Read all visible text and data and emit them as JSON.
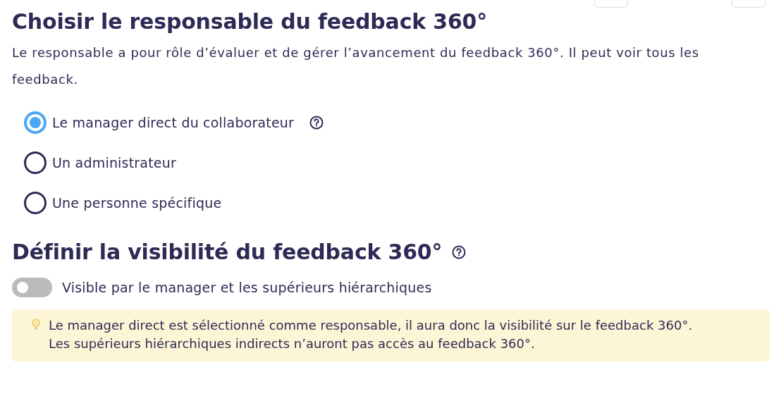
{
  "owner_section": {
    "title": "Choisir le responsable du feedback 360°",
    "description": "Le responsable a pour rôle d’évaluer et de gérer l’avancement du feedback 360°. Il peut voir tous les feedback.",
    "options": [
      {
        "label": "Le manager direct du collaborateur",
        "selected": true,
        "help": true
      },
      {
        "label": "Un administrateur",
        "selected": false,
        "help": false
      },
      {
        "label": "Une personne spécifique",
        "selected": false,
        "help": false
      }
    ]
  },
  "visibility_section": {
    "title": "Définir la visibilité du feedback 360°",
    "help": true,
    "toggle": {
      "label": "Visible par le manager et les supérieurs hiérarchiques",
      "on": false
    },
    "info": [
      "Le manager direct est sélectionné comme responsable, il aura donc la visibilité sur le feedback 360°.",
      "Les supérieurs hiérarchiques indirects n’auront pas accès au feedback 360°."
    ]
  }
}
